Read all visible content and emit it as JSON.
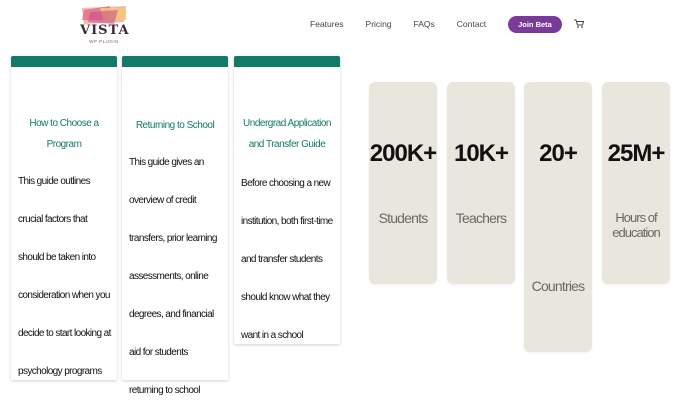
{
  "header": {
    "logo_word": "VISTA",
    "logo_tagline": "WP PLUGIN",
    "nav": [
      "Features",
      "Pricing",
      "FAQs",
      "Contact"
    ],
    "cta": "Join Beta",
    "cart_icon": "cart-icon"
  },
  "cards": [
    {
      "title": "How to Choose a Program",
      "body": "This guide outlines crucial factors that should be taken into consideration when you decide to start looking at psychology programs"
    },
    {
      "title": "Returning to School",
      "body": "This guide gives an overview of credit transfers, prior learning assessments, online degrees, and financial aid for students returning to school"
    },
    {
      "title": "Undergrad Application and Transfer Guide",
      "body": "Before choosing a new institution, both first-time and transfer students should know what they want in a school"
    }
  ],
  "stats": [
    {
      "value": "200K+",
      "label": "Students"
    },
    {
      "value": "10K+",
      "label": "Teachers"
    },
    {
      "value": "20+",
      "label": "Countries"
    },
    {
      "value": "25M+",
      "label": "Hours of education"
    }
  ],
  "colors": {
    "accent": "#137a68",
    "cta": "#7a3a9a",
    "stat_bg": "#e8e6dd"
  }
}
